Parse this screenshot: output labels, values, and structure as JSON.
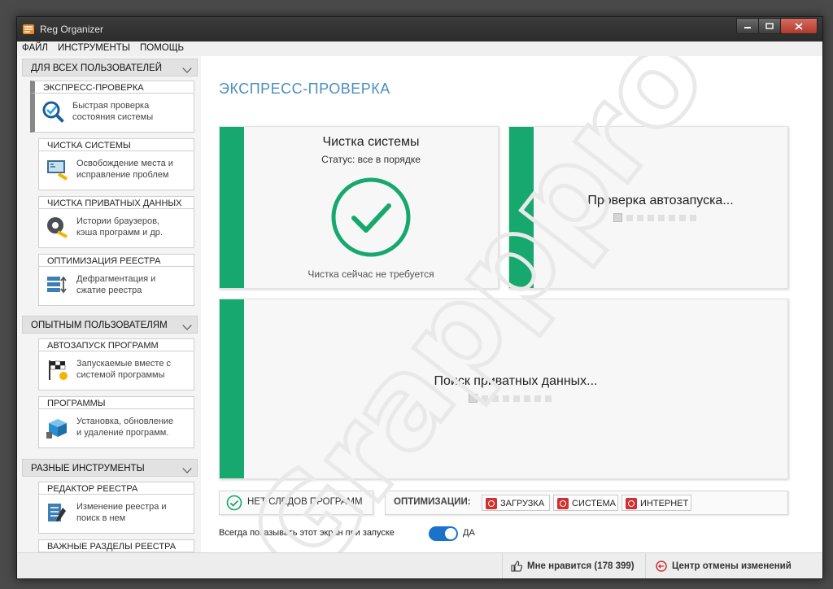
{
  "window": {
    "title": "Reg Organizer"
  },
  "menu": [
    "ФАЙЛ",
    "ИНСТРУМЕНТЫ",
    "ПОМОЩЬ"
  ],
  "sidebar": {
    "groups": [
      {
        "label": "ДЛЯ ВСЕХ ПОЛЬЗОВАТЕЛЕЙ"
      },
      {
        "label": "ОПЫТНЫМ ПОЛЬЗОВАТЕЛЯМ"
      },
      {
        "label": "РАЗНЫЕ ИНСТРУМЕНТЫ"
      }
    ],
    "items": [
      {
        "label": "ЭКСПРЕСС-ПРОВЕРКА",
        "desc1": "Быстрая проверка",
        "desc2": "состояния системы"
      },
      {
        "label": "ЧИСТКА СИСТЕМЫ",
        "desc1": "Освобождение места и",
        "desc2": "исправление проблем"
      },
      {
        "label": "ЧИСТКА ПРИВАТНЫХ ДАННЫХ",
        "desc1": "Истории браузеров,",
        "desc2": "кэша программ и др."
      },
      {
        "label": "ОПТИМИЗАЦИЯ РЕЕСТРА",
        "desc1": "Дефрагментация и",
        "desc2": "сжатие реестра"
      },
      {
        "label": "АВТОЗАПУСК ПРОГРАММ",
        "desc1": "Запускаемые вместе с",
        "desc2": "системой программы"
      },
      {
        "label": "ПРОГРАММЫ",
        "desc1": "Установка, обновление",
        "desc2": "и удаление программ."
      },
      {
        "label": "РЕДАКТОР РЕЕСТРА",
        "desc1": "Изменение реестра и",
        "desc2": "поиск в нем"
      },
      {
        "label": "ВАЖНЫЕ РАЗДЕЛЫ РЕЕСТРА"
      }
    ]
  },
  "main": {
    "title": "ЭКСПРЕСС-ПРОВЕРКА",
    "card_system": {
      "title": "Чистка системы",
      "status": "Статус: все в порядке",
      "note": "Чистка сейчас не требуется"
    },
    "card_autorun": {
      "title": "Проверка автозапуска..."
    },
    "card_private": {
      "title": "Поиск приватных данных..."
    },
    "no_traces": "НЕТ СЛЕДОВ ПРОГРАММ",
    "optimizations": {
      "label": "ОПТИМИЗАЦИИ:",
      "boot": "ЗАГРУЗКА",
      "system": "СИСТЕМА",
      "internet": "ИНТЕРНЕТ"
    },
    "show_on_start": {
      "label": "Всегда показывать этот экран при запуске",
      "value": "ДА"
    }
  },
  "statusbar": {
    "likes": "Мне нравится (178 399)",
    "undo": "Центр отмены изменений"
  },
  "watermark": "Grapppro",
  "colors": {
    "accent_green": "#16a86f",
    "title_blue": "#4a8fbf",
    "toggle_blue": "#1a73c9",
    "danger_red": "#d32f2f"
  }
}
